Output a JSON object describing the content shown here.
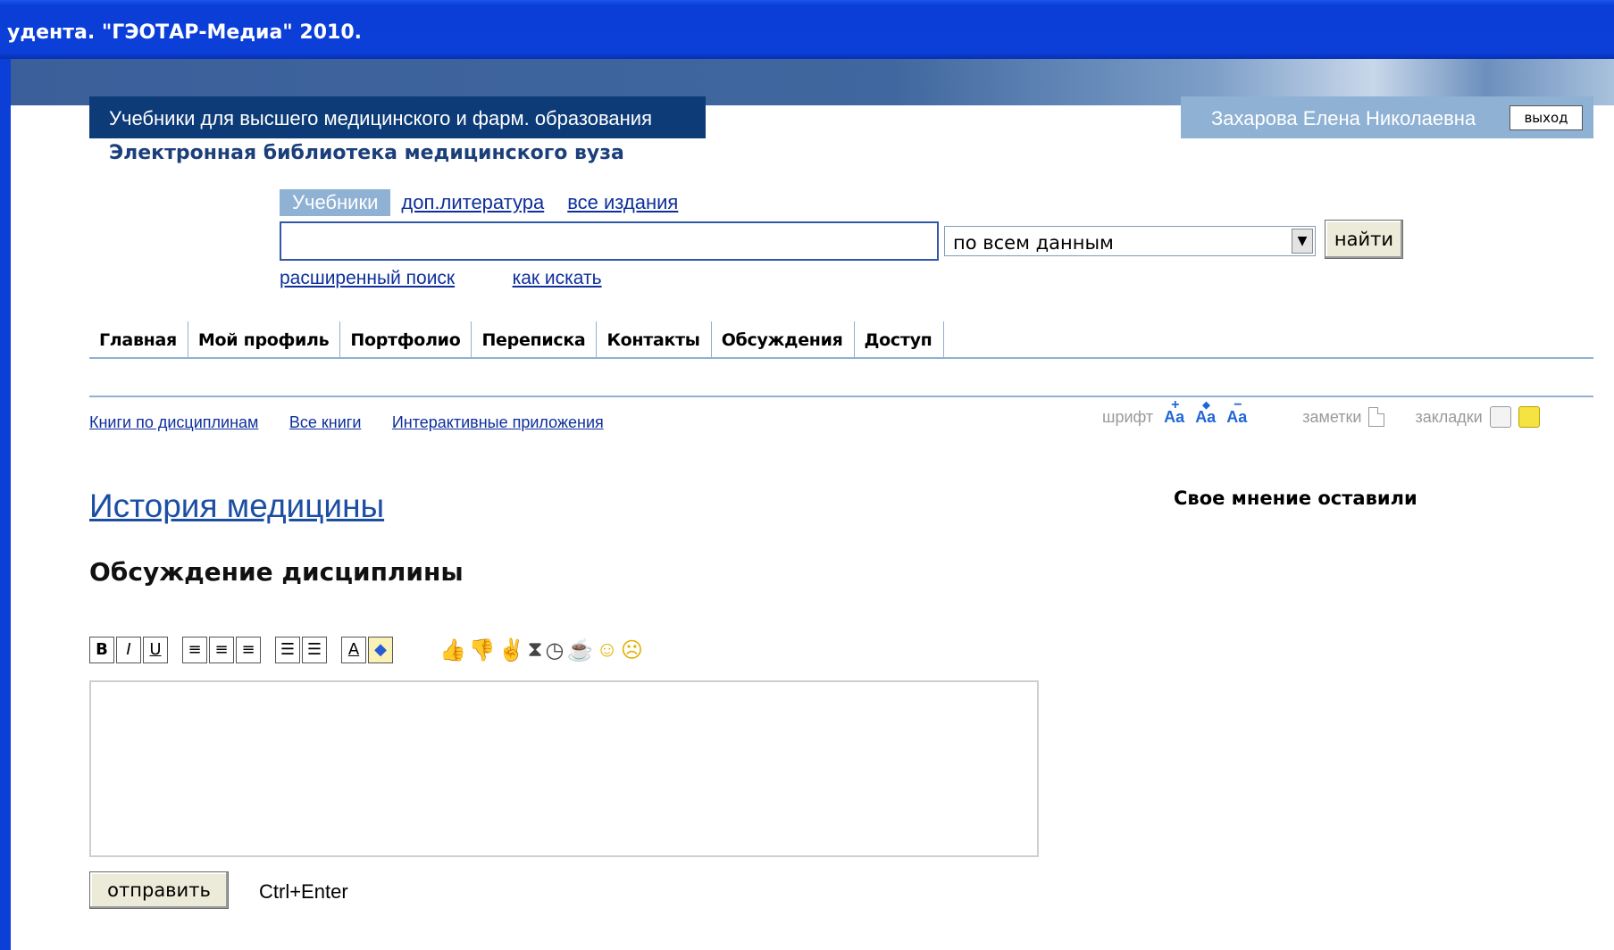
{
  "window": {
    "title": "удента. \"ГЭОТАР-Медиа\" 2010."
  },
  "header": {
    "brand": "Учебники для высшего медицинского и фарм. образования",
    "subtitle": "Электронная библиотека медицинского вуза",
    "user_name": "Захарова Елена Николаевна",
    "logout_label": "выход"
  },
  "search": {
    "tabs": [
      {
        "label": "Учебники",
        "active": true
      },
      {
        "label": "доп.литература",
        "active": false
      },
      {
        "label": "все издания",
        "active": false
      }
    ],
    "query_value": "",
    "scope_selected": "по всем данным",
    "find_label": "найти",
    "advanced_label": "расширенный поиск",
    "help_label": "как искать"
  },
  "main_nav": {
    "items": [
      "Главная",
      "Мой профиль",
      "Портфолио",
      "Переписка",
      "Контакты",
      "Обсуждения",
      "Доступ"
    ]
  },
  "sub_nav": {
    "items": [
      "Книги по дисциплинам",
      "Все книги",
      "Интерактивные приложения"
    ]
  },
  "tools": {
    "font_label": "шрифт",
    "font_glyph": "Aa",
    "font_plus": "+",
    "font_reset": "◆",
    "font_minus": "−",
    "notes_label": "заметки",
    "bookmarks_label": "закладки"
  },
  "content": {
    "discipline_title": "История медицины",
    "discussion_heading": "Обсуждение дисциплины",
    "opinion_label": "Свое мнение оставили"
  },
  "editor": {
    "bold": "B",
    "italic": "I",
    "underline": "U",
    "align_left": "≡",
    "align_center": "≡",
    "align_right": "≡",
    "ordered_list": "☰",
    "unordered_list": "☰",
    "text_color": "A",
    "fill_color": "◆",
    "message_value": "",
    "send_label": "отправить",
    "shortcut_hint": "Ctrl+Enter"
  },
  "icons": {
    "emoticons": [
      "thumbs-up-icon",
      "thumbs-down-icon",
      "victory-icon",
      "hourglass-icon",
      "clock-icon",
      "coffee-icon",
      "smile-icon",
      "sad-icon"
    ]
  },
  "colors": {
    "titlebar": "#0b3fd8",
    "brand_bg": "#0d3b78",
    "accent_light": "#8fb1d4",
    "link": "#0e2f9c"
  }
}
